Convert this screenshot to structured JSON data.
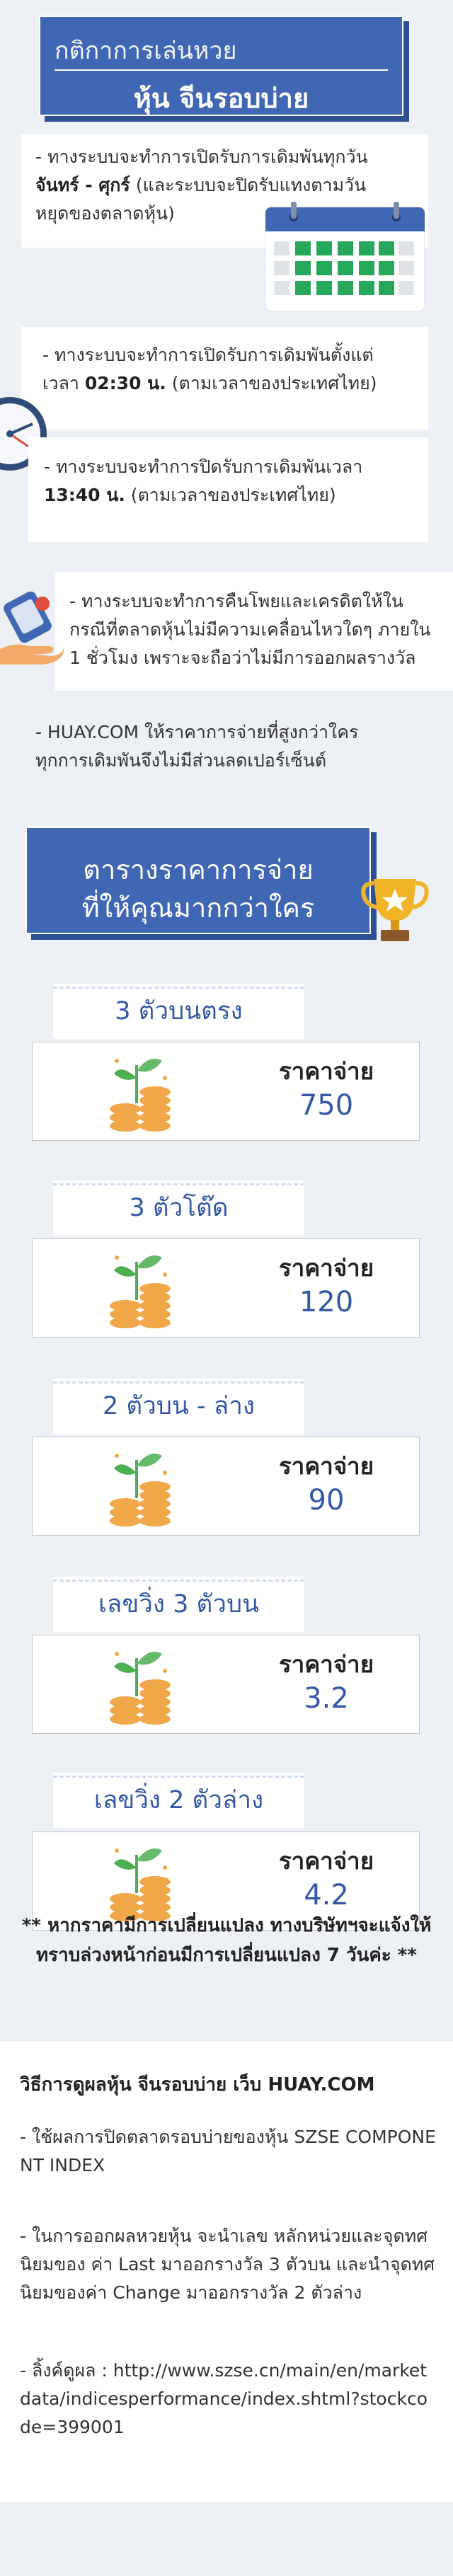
{
  "header": {
    "subtitle": "กติกาการเล่นหวย",
    "title": "หุ้น จีนรอบบ่าย"
  },
  "rules": {
    "r1_prefix": "-    ทางระบบจะทำการเปิดรับการเดิมพันทุกวัน",
    "r1_days": "จันทร์ - ศุกร์",
    "r1_suffix": " (และระบบจะปิดรับแทงตามวัน",
    "r1_line3": "หยุดของตลาดหุ้น)",
    "r2_line1": "-    ทางระบบจะทำการเปิดรับการเดิมพันตั้งแต่",
    "r2_prefix": "เวลา ",
    "r2_time": "02:30 น.",
    "r2_suffix": " (ตามเวลาของประเทศไทย)",
    "r3_line1": "-    ทางระบบจะทำการปิดรับการเดิมพันเวลา",
    "r3_time": "13:40 น.",
    "r3_suffix": " (ตามเวลาของประเทศไทย)",
    "r4_line1": "-    ทางระบบจะทำการคืนโพยและเครดิตให้ใน",
    "r4_line2": "กรณีที่ตลาดหุ้นไม่มีความเคลื่อนไหวใดๆ ภายใน",
    "r4_line3": "1 ชั่วโมง เพราะจะถือว่าไม่มีการออกผลรางวัล",
    "r5_line1": "-    HUAY.COM ให้ราคาการจ่ายที่สูงกว่าใคร",
    "r5_line2": "ทุกการเดิมพันจึงไม่มีส่วนลดเปอร์เซ็นต์"
  },
  "banner": {
    "line1": "ตารางราคาการจ่าย",
    "line2": "ที่ให้คุณมากกว่าใคร"
  },
  "prices": [
    {
      "name": "3 ตัวบนตรง",
      "label": "ราคาจ่าย",
      "value": "750"
    },
    {
      "name": "3 ตัวโต๊ด",
      "label": "ราคาจ่าย",
      "value": "120"
    },
    {
      "name": "2 ตัวบน - ล่าง",
      "label": "ราคาจ่าย",
      "value": "90"
    },
    {
      "name": "เลขวิ่ง 3 ตัวบน",
      "label": "ราคาจ่าย",
      "value": "3.2"
    },
    {
      "name": "เลขวิ่ง 2 ตัวล่าง",
      "label": "ราคาจ่าย",
      "value": "4.2"
    }
  ],
  "note": {
    "line1": "** หากราคามีการเปลี่ยนแปลง ทางบริษัทฯจะแจ้งให้",
    "line2": "ทราบล่วงหน้าก่อนมีการเปลี่ยนแปลง 7 วันค่ะ **"
  },
  "howto": {
    "title": "วิธีการดูผลหุ้น จีนรอบบ่าย เว็บ HUAY.COM",
    "p1": "      -    ใช้ผลการปิดตลาดรอบบ่ายของหุ้น SZSE COMPONENT INDEX",
    "p2": "      -    ในการออกผลหวยหุ้น จะนำเลข หลักหน่วยและจุดทศนิยมของ ค่า Last มาออกรางวัล 3 ตัวบน และนำจุดทศนิยมของค่า Change มาออกรางวัล 2 ตัวล่าง",
    "p3": "      -    ลิ้งค์ดูผล : http://www.szse.cn/main/en/marketdata/indicesperformance/index.shtml?stockcode=399001"
  }
}
